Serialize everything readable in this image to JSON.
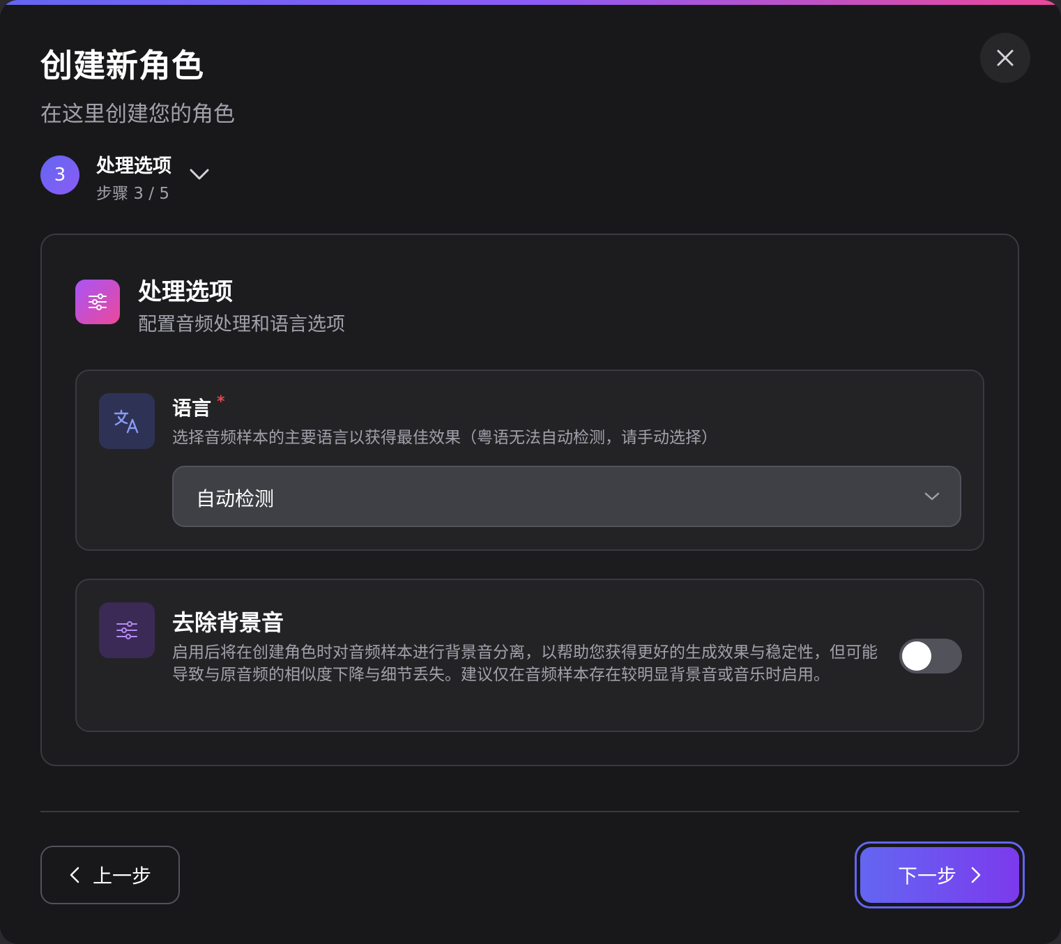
{
  "dialog": {
    "title": "创建新角色",
    "subtitle": "在这里创建您的角色"
  },
  "step": {
    "number": "3",
    "title": "处理选项",
    "count": "步骤 3 / 5"
  },
  "panel": {
    "title": "处理选项",
    "description": "配置音频处理和语言选项"
  },
  "language": {
    "title": "语言",
    "required_mark": "*",
    "description": "选择音频样本的主要语言以获得最佳效果（粤语无法自动检测，请手动选择）",
    "selected": "自动检测"
  },
  "background_removal": {
    "title": "去除背景音",
    "description": "启用后将在创建角色时对音频样本进行背景音分离，以帮助您获得更好的生成效果与稳定性，但可能导致与原音频的相似度下降与细节丢失。建议仅在音频样本存在较明显背景音或音乐时启用。",
    "enabled": false
  },
  "footer": {
    "prev_label": "上一步",
    "next_label": "下一步"
  },
  "colors": {
    "accent": "#6366f1",
    "accent_purple": "#8b5cf6",
    "required": "#ef4444",
    "background": "#18181b"
  },
  "icons": {
    "close": "close-icon",
    "step_toggle": "chevron-down-icon",
    "panel": "sliders-icon",
    "language": "translate-icon",
    "background_removal": "sliders-icon",
    "select": "chevron-down-icon",
    "prev": "chevron-left-icon",
    "next": "chevron-right-icon"
  }
}
